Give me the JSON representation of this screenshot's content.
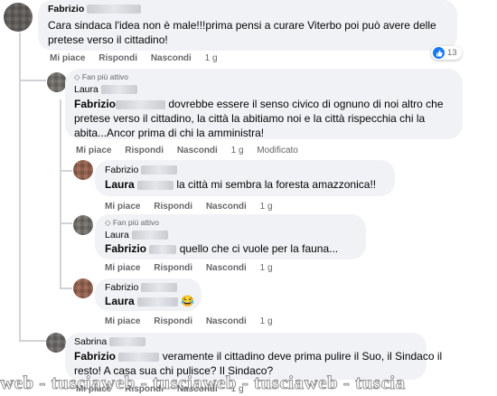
{
  "labels": {
    "reply_action": "Mi piace",
    "respond_action": "Rispondi",
    "hide_action": "Nascondi",
    "fan_badge": "Fan più attivo"
  },
  "comments": [
    {
      "author": "Fabrizio",
      "line1": "Cara sindaca l'idea non è male!!!prima pensi a curare Viterbo poi può avere delle",
      "line2": "pretese verso il cittadino!",
      "time": "1 g",
      "reactions": "13"
    },
    {
      "author": "Laura",
      "mention": "Fabrizio",
      "line1": " dovrebbe essere il senso civico di ognuno di noi altro che",
      "line2": "pretese verso il cittadino, la città la abitiamo noi e la città rispecchia chi la",
      "line3": "abita...Ancor prima di chi la amministra!",
      "time": "1 g",
      "edited": "Modificato"
    },
    {
      "author": "Fabrizio",
      "mention": "Laura",
      "line1": " la città mi sembra la foresta amazzonica!!",
      "time": "1 g"
    },
    {
      "author": "Laura",
      "mention": "Fabrizio",
      "line1": " quello che ci vuole per la fauna...",
      "time": "1 g"
    },
    {
      "author": "Fabrizio",
      "mention": "Laura",
      "emoji": "😂",
      "time": "1 g"
    },
    {
      "author": "Sabrina",
      "mention": "Fabrizio",
      "line1": " veramente il cittadino deve prima pulire il Suo, il Sindaco il",
      "line2": "resto! A casa sua chi pulisce? Il Sindaco?",
      "time": "1 g"
    }
  ],
  "watermark": "web - tusciaweb - tusciaweb - tusciaweb - tuscia"
}
